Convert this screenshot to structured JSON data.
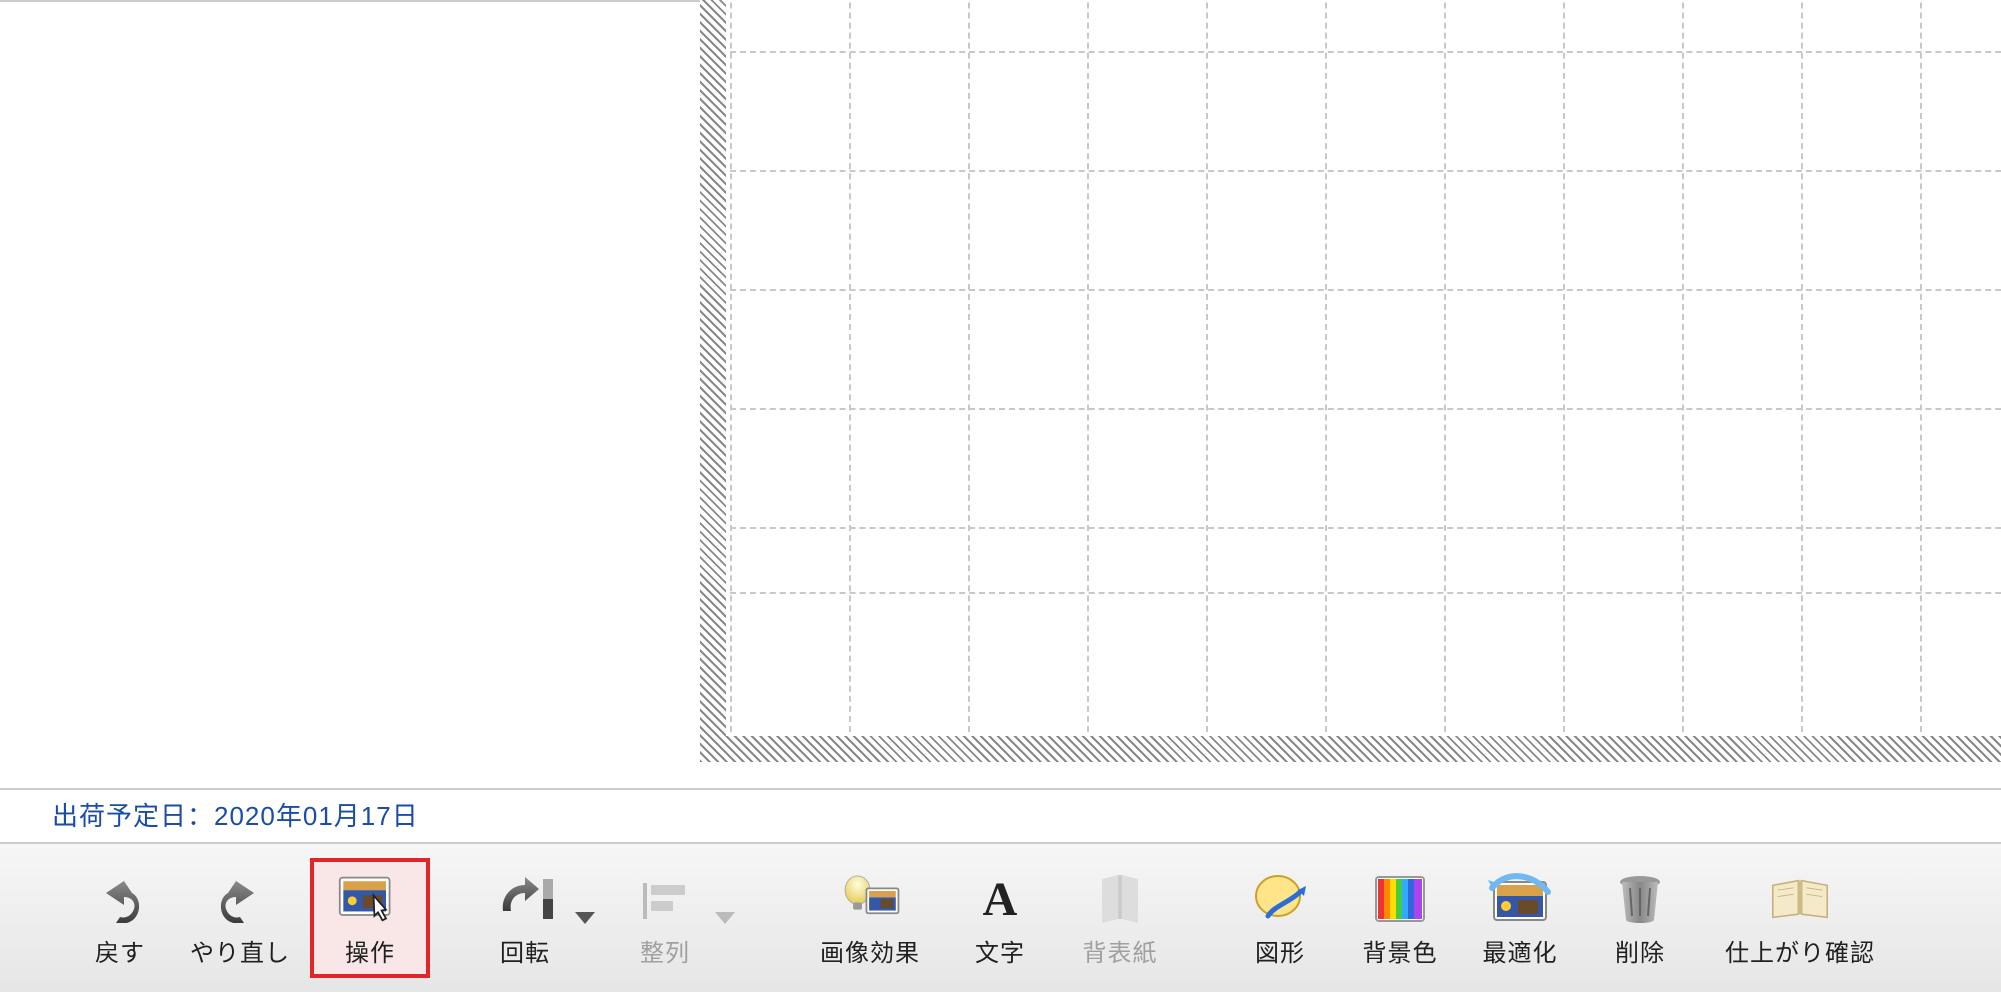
{
  "status": {
    "shipping_label": "出荷予定日：",
    "shipping_value": "2020年01月17日"
  },
  "toolbar": {
    "undo": "戻す",
    "redo": "やり直し",
    "operate": "操作",
    "rotate": "回転",
    "align": "整列",
    "image_effect": "画像効果",
    "text": "文字",
    "spine": "背表紙",
    "shape": "図形",
    "bgcolor": "背景色",
    "optimize": "最適化",
    "delete": "削除",
    "preview": "仕上がり確認"
  }
}
